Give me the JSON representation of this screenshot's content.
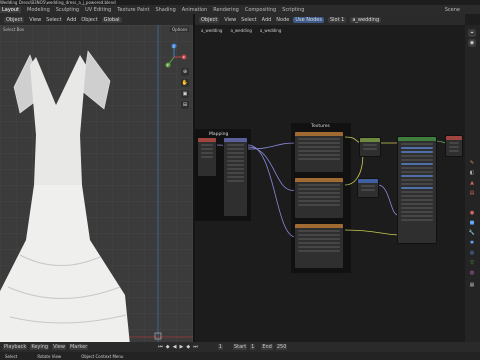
{
  "breadcrumb": "Wedding Dress\\B3NO5\\wedding_dress_a_j_powered.blend",
  "workspaces": [
    "Layout",
    "Modeling",
    "Sculpting",
    "UV Editing",
    "Texture Paint",
    "Shading",
    "Animation",
    "Rendering",
    "Compositing",
    "Scripting"
  ],
  "active_workspace": "Layout",
  "scene_label": "Scene",
  "viewport": {
    "mode": "Object Mode",
    "mode_short": "Object",
    "menus": [
      "View",
      "Select",
      "Add",
      "Object"
    ],
    "global_label": "Global",
    "select_box_label": "Select Box",
    "options_label": "Options",
    "gizmo_axes": [
      "X",
      "Y",
      "Z"
    ],
    "tool_icons": [
      "zoom-icon",
      "pan-icon",
      "camera-icon",
      "grid-icon"
    ]
  },
  "node_editor": {
    "editor_type": "Object",
    "menus": [
      "View",
      "Select",
      "Add",
      "Node"
    ],
    "use_nodes_label": "Use Nodes",
    "slot_label": "Slot 1",
    "material_label": "a_wedding",
    "breadcrumb": [
      "a_wedding",
      "a_wedding",
      "a_wedding"
    ],
    "frames": [
      {
        "label": "Mapping"
      },
      {
        "label": "Textures"
      }
    ],
    "nodes": [
      {
        "name": "texture-coordinate",
        "color": "#a0443f",
        "rows": 6
      },
      {
        "name": "mapping",
        "color": "#5a5f9a",
        "rows": 10
      },
      {
        "name": "image-texture-1",
        "color": "#a06b33",
        "rows": 7
      },
      {
        "name": "image-texture-2",
        "color": "#a06b33",
        "rows": 7
      },
      {
        "name": "image-texture-3",
        "color": "#a06b33",
        "rows": 7
      },
      {
        "name": "mix-node",
        "color": "#6e8a3e",
        "rows": 4
      },
      {
        "name": "normal-map",
        "color": "#3f5fa0",
        "rows": 4
      },
      {
        "name": "principled-bsdf",
        "color": "#3e7d3e",
        "rows": 22
      },
      {
        "name": "material-output",
        "color": "#a0443f",
        "rows": 3
      }
    ],
    "side_tool_icons": [
      "tool-icon",
      "view-icon",
      "node-icon",
      "options-icon",
      "properties-icon",
      "material-icon",
      "world-icon",
      "scene-icon",
      "render-icon"
    ]
  },
  "timeline": {
    "menus": [
      "Playback",
      "Keying",
      "View",
      "Marker"
    ],
    "start_label": "Start",
    "start": "1",
    "end_label": "End",
    "end": "250",
    "current_frame": "1",
    "controls": [
      "jump-start-icon",
      "prev-key-icon",
      "play-reverse-icon",
      "play-icon",
      "next-key-icon",
      "jump-end-icon"
    ]
  },
  "statusbar": {
    "items": [
      "Select",
      "Rotate View",
      "Object Context Menu"
    ]
  }
}
